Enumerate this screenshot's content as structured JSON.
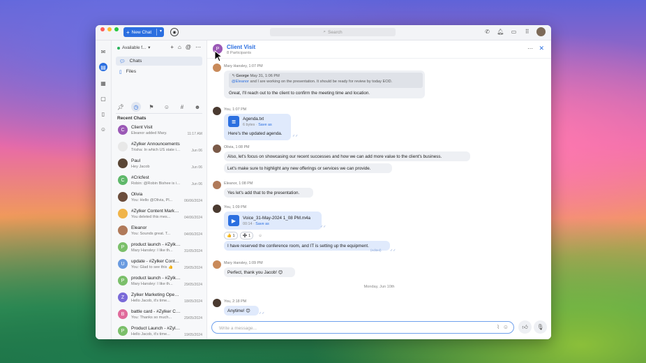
{
  "topbar": {
    "new_chat_label": "New Chat",
    "search_placeholder": "Search"
  },
  "sidebar": {
    "status": "Available f...",
    "nav": [
      {
        "label": "Chats"
      },
      {
        "label": "Files"
      }
    ],
    "recent_label": "Recent Chats",
    "chats": [
      {
        "name": "Client Visit",
        "preview": "Eleanor added Mary.",
        "time": "11:17 AM",
        "avatar_letter": "C",
        "avatar_color": "#9b59b6"
      },
      {
        "name": "#Zylker Announcements",
        "preview": "Trisha: In which US state is...",
        "time": "Jun 06",
        "avatar_letter": "",
        "avatar_color": "#e8e8e8"
      },
      {
        "name": "Paul",
        "preview": "Hey Jacob",
        "time": "Jun 06",
        "avatar_letter": "",
        "avatar_color": "#5a4636"
      },
      {
        "name": "#Cricfest",
        "preview": "Robin: @Robin Bishee is in...",
        "time": "Jun 06",
        "avatar_letter": "C",
        "avatar_color": "#5fb86a"
      },
      {
        "name": "Olivia",
        "preview": "You: Hello @Olivia, Pl...",
        "time": "06/06/2024",
        "avatar_letter": "",
        "avatar_color": "#6b4d3c"
      },
      {
        "name": "#Zylker Content Marketing",
        "preview": "You deleted this mes...",
        "time": "04/06/2024",
        "avatar_letter": "",
        "avatar_color": "#f0b44a"
      },
      {
        "name": "Eleanor",
        "preview": "You: Sounds great. T...",
        "time": "04/06/2024",
        "avatar_letter": "",
        "avatar_color": "#b07a5a"
      },
      {
        "name": "product launch - #Zylker Event...",
        "preview": "Mary Hansley: I like th...",
        "time": "31/05/2024",
        "avatar_letter": "P",
        "avatar_color": "#7bbf6a"
      },
      {
        "name": "update - #Zylker Content Mark...",
        "preview": "You: Glad to see this 👍",
        "time": "29/05/2024",
        "avatar_letter": "U",
        "avatar_color": "#6a9be0"
      },
      {
        "name": "product launch - #Zylker Conte...",
        "preview": "Mary Hansley: I like th...",
        "time": "29/05/2024",
        "avatar_letter": "P",
        "avatar_color": "#7bbf6a"
      },
      {
        "name": "Zylker Marketing Openhouse -...",
        "preview": "Hello Jacob, it's time...",
        "time": "18/05/2024",
        "avatar_letter": "Z",
        "avatar_color": "#7a6ad8"
      },
      {
        "name": "battle card - #Zylker Content M...",
        "preview": "You: Thanks so much...",
        "time": "29/05/2024",
        "avatar_letter": "B",
        "avatar_color": "#e06a9b"
      },
      {
        "name": "Product Launch - #Zylker Event...",
        "preview": "Hello Jacob, it's time...",
        "time": "19/05/2024",
        "avatar_letter": "P",
        "avatar_color": "#7bbf6a"
      },
      {
        "name": "product launch - #Zylker Event...",
        "preview": "Hello Jacob, it's time...",
        "time": "19/05/2024",
        "avatar_letter": "P",
        "avatar_color": "#7bbf6a"
      }
    ]
  },
  "header": {
    "title": "Client Visit",
    "subtitle": "8 Participants",
    "avatar_letter": "P"
  },
  "messages": {
    "m1_meta": "Mary Hansley, 1:07 PM",
    "m1_quote_author": "George",
    "m1_quote_time": "May 31, 1:06 PM",
    "m1_quote_mention": "@Eleanor",
    "m1_quote_text": " and I are working on the presentation. It should be ready for review by today EOD.",
    "m1_text": "Great, I'll reach out to the client to confirm the meeting time and location.",
    "m2_meta": "You, 1:07 PM",
    "m2_file_name": "Agenda.txt",
    "m2_file_size": "6 bytes",
    "m2_file_action": "Save as",
    "m2_text": "Here's the updated agenda.",
    "m3_meta": "Olivia, 1:08 PM",
    "m3_text1": "Also, let's focus on showcasing our recent successes and how we can add more value to the client's business.",
    "m3_text2": "Let's make sure to highlight any new offerings or services we can provide.",
    "m4_meta": "Eleanor, 1:08 PM",
    "m4_text": "Yes let's add that to the presentation.",
    "m5_meta": "You, 1:09 PM",
    "m5_file_name": "Voice_31-May-2024 1_08 PM.m4a",
    "m5_file_size": "00:14",
    "m5_file_action": "Save as",
    "m5_reaction1": "👍 1",
    "m5_reaction2": "➕ 1",
    "m5_text": "I have reserved the conference room, and IT is setting up the equipment.",
    "m5_edited": "(edited)",
    "m6_meta": "Mary Hansley, 1:09 PM",
    "m6_text": "Perfect, thank you Jacob! 😊",
    "date_separator": "Monday, Jun 10th",
    "m7_meta": "You, 2:18 PM",
    "m7_text": "Anytime! 😊"
  },
  "composer": {
    "placeholder": "Write a message..."
  },
  "colors": {
    "accent": "#2b6fe0",
    "online": "#29b35a"
  }
}
